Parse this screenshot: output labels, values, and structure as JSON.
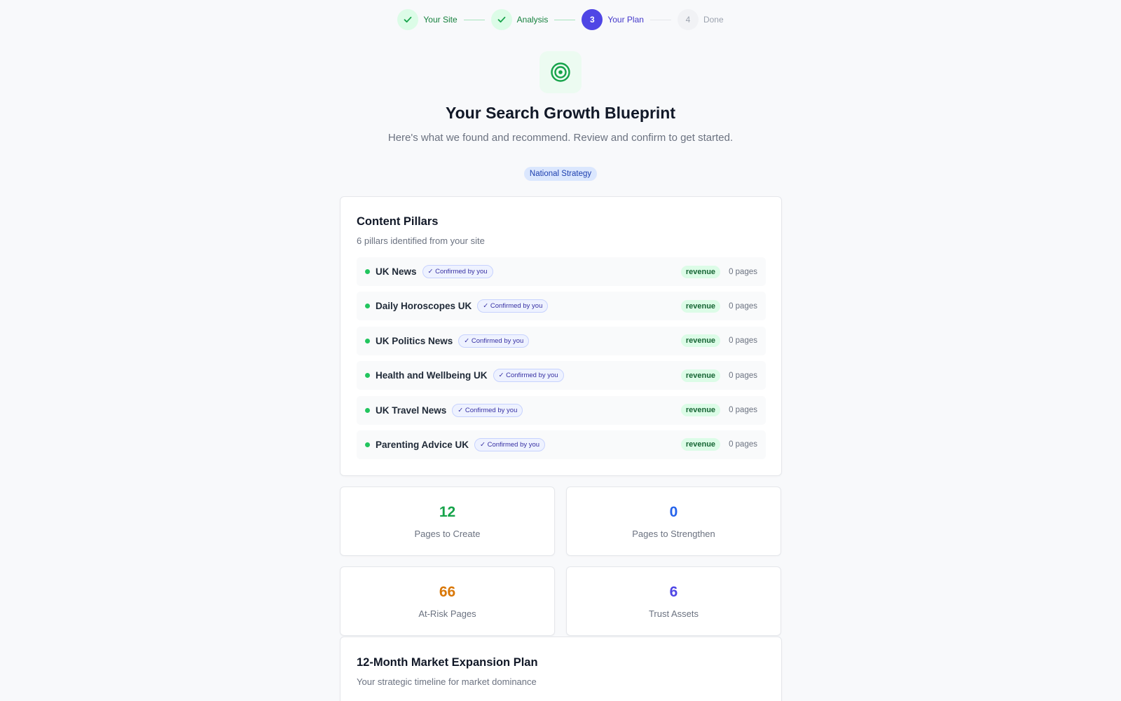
{
  "stepper": {
    "steps": [
      {
        "label": "Your Site",
        "state": "done",
        "number": "1"
      },
      {
        "label": "Analysis",
        "state": "done",
        "number": "2"
      },
      {
        "label": "Your Plan",
        "state": "active",
        "number": "3"
      },
      {
        "label": "Done",
        "state": "pending",
        "number": "4"
      }
    ]
  },
  "hero": {
    "icon": "target-icon",
    "title": "Your Search Growth Blueprint",
    "subtitle": "Here's what we found and recommend. Review and confirm to get started.",
    "strategy_badge": "National Strategy"
  },
  "pillars": {
    "title": "Content Pillars",
    "subtitle": "6 pillars identified from your site",
    "items": [
      {
        "name": "UK News",
        "confirm": "✓ Confirmed by you",
        "tag": "revenue",
        "pages": "0 pages"
      },
      {
        "name": "Daily Horoscopes UK",
        "confirm": "✓ Confirmed by you",
        "tag": "revenue",
        "pages": "0 pages"
      },
      {
        "name": "UK Politics News",
        "confirm": "✓ Confirmed by you",
        "tag": "revenue",
        "pages": "0 pages"
      },
      {
        "name": "Health and Wellbeing UK",
        "confirm": "✓ Confirmed by you",
        "tag": "revenue",
        "pages": "0 pages"
      },
      {
        "name": "UK Travel News",
        "confirm": "✓ Confirmed by you",
        "tag": "revenue",
        "pages": "0 pages"
      },
      {
        "name": "Parenting Advice UK",
        "confirm": "✓ Confirmed by you",
        "tag": "revenue",
        "pages": "0 pages"
      }
    ]
  },
  "stats": {
    "create": {
      "value": "12",
      "label": "Pages to Create",
      "color": "#16a34a"
    },
    "strengthen": {
      "value": "0",
      "label": "Pages to Strengthen",
      "color": "#2563eb"
    },
    "at_risk": {
      "value": "66",
      "label": "At-Risk Pages",
      "color": "#d97706"
    },
    "trust": {
      "value": "6",
      "label": "Trust Assets",
      "color": "#4f46e5"
    }
  },
  "plan": {
    "title": "12-Month Market Expansion Plan",
    "subtitle": "Your strategic timeline for market dominance"
  },
  "colors": {
    "accent": "#4f46e5",
    "success": "#22c55e",
    "background": "#f8f9fb"
  }
}
